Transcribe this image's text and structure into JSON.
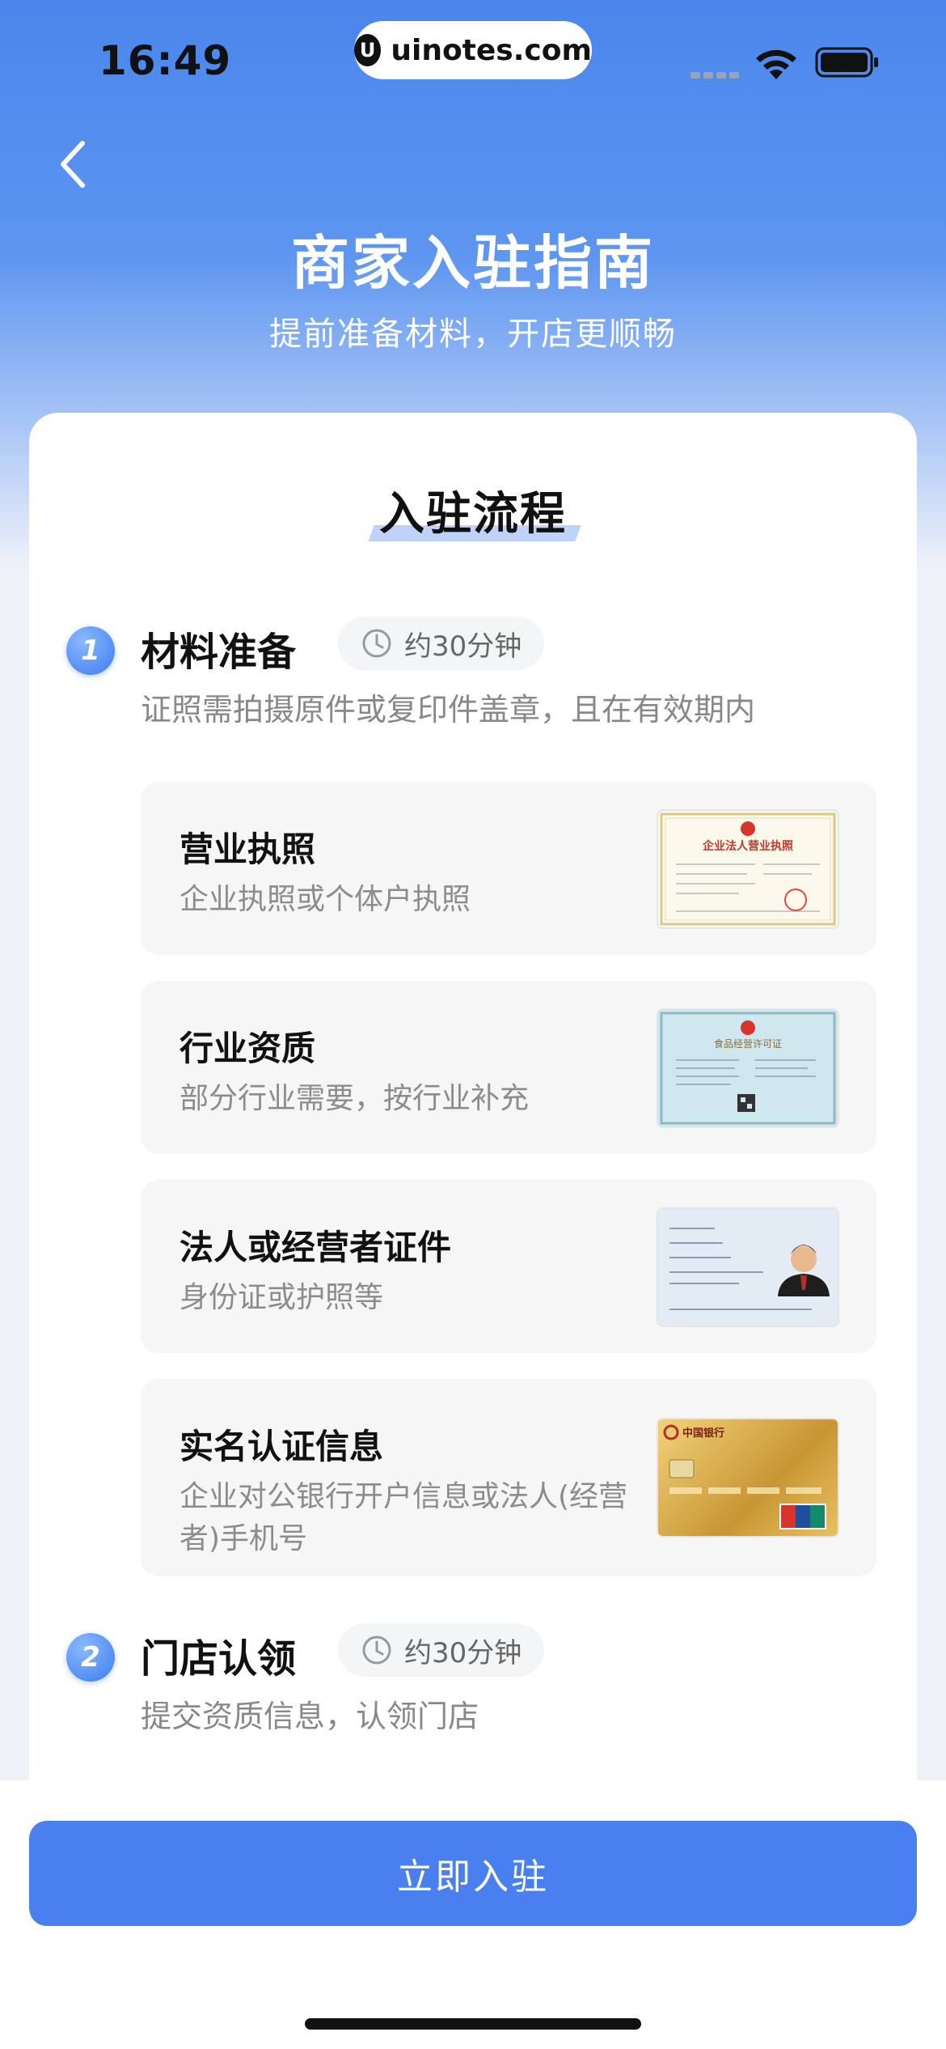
{
  "status_bar": {
    "time": "16:49",
    "watermark": "uinotes.com"
  },
  "header": {
    "title": "商家入驻指南",
    "subtitle": "提前准备材料，开店更顺畅"
  },
  "flow": {
    "title": "入驻流程",
    "steps": [
      {
        "number": "1",
        "name": "材料准备",
        "duration": "约30分钟",
        "description": "证照需拍摄原件或复印件盖章，且在有效期内",
        "items": [
          {
            "title": "营业执照",
            "description": "企业执照或个体户执照",
            "thumb_text": "企业法人营业执照"
          },
          {
            "title": "行业资质",
            "description": "部分行业需要，按行业补充",
            "thumb_text": "食品经营许可证"
          },
          {
            "title": "法人或经营者证件",
            "description": "身份证或护照等"
          },
          {
            "title": "实名认证信息",
            "description": "企业对公银行开户信息或法人(经营者)手机号",
            "thumb_text": "中国银行"
          }
        ]
      },
      {
        "number": "2",
        "name": "门店认领",
        "duration": "约30分钟",
        "description": "提交资质信息，认领门店"
      }
    ]
  },
  "cta": {
    "label": "立即入驻"
  },
  "colors": {
    "primary": "#4a7ff0",
    "header_blue": "#4a86ec"
  }
}
